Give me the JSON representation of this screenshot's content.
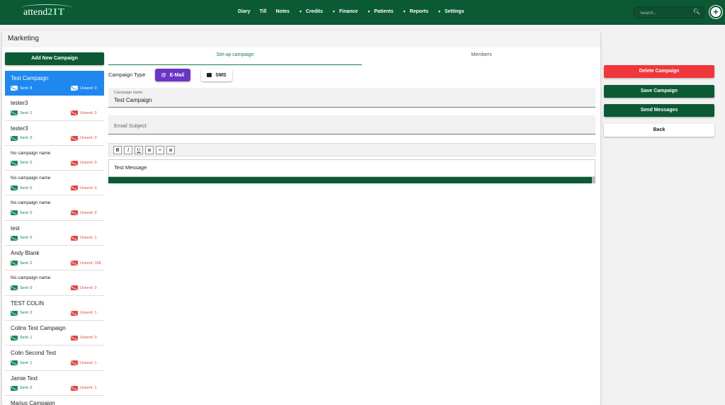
{
  "header": {
    "logo_text": "attend",
    "logo_accent": "2IT",
    "nav": [
      {
        "label": "Diary",
        "has_caret": false
      },
      {
        "label": "Till",
        "has_caret": false
      },
      {
        "label": "Notes",
        "has_caret": false
      },
      {
        "label": "Credits",
        "has_caret": true
      },
      {
        "label": "Finance",
        "has_caret": true
      },
      {
        "label": "Patients",
        "has_caret": true
      },
      {
        "label": "Reports",
        "has_caret": true
      },
      {
        "label": "Settings",
        "has_caret": true
      }
    ],
    "search_placeholder": "Search...",
    "search_icon": "search-icon",
    "add_icon": "plus-circle-icon"
  },
  "page": {
    "title": "Marketing",
    "add_button": "Add New Campaign"
  },
  "campaigns": [
    {
      "name": "Test Campaign",
      "small": false,
      "sent": "Sent: 8",
      "unsent": "Unsent: 0",
      "active": true
    },
    {
      "name": "tester3",
      "small": false,
      "sent": "Sent: 1",
      "unsent": "Unsent: 0",
      "active": false
    },
    {
      "name": "tester3",
      "small": false,
      "sent": "Sent: 0",
      "unsent": "Unsent: 0",
      "active": false
    },
    {
      "name": "No campaign name",
      "small": true,
      "sent": "Sent: 0",
      "unsent": "Unsent: 0",
      "active": false
    },
    {
      "name": "No campaign name",
      "small": true,
      "sent": "Sent: 0",
      "unsent": "Unsent: 0",
      "active": false
    },
    {
      "name": "No campaign name",
      "small": true,
      "sent": "Sent: 0",
      "unsent": "Unsent: 0",
      "active": false
    },
    {
      "name": "test",
      "small": false,
      "sent": "Sent: 0",
      "unsent": "Unsent: 1",
      "active": false
    },
    {
      "name": "Andy Blank",
      "small": false,
      "sent": "Sent: 0",
      "unsent": "Unsent: 158",
      "active": false
    },
    {
      "name": "No campaign name",
      "small": true,
      "sent": "Sent: 0",
      "unsent": "Unsent: 0",
      "active": false
    },
    {
      "name": "TEST COLIN",
      "small": false,
      "sent": "Sent: 0",
      "unsent": "Unsent: 1",
      "active": false
    },
    {
      "name": "Colins Test Campaign",
      "small": false,
      "sent": "Sent: 1",
      "unsent": "Unsent: 0",
      "active": false
    },
    {
      "name": "Colin Second Test",
      "small": false,
      "sent": "Sent: 1",
      "unsent": "Unsent: 1",
      "active": false
    },
    {
      "name": "Jamie Text",
      "small": false,
      "sent": "Sent: 0",
      "unsent": "Unsent: 1",
      "active": false
    },
    {
      "name": "Marius Campaign",
      "small": false,
      "sent": "",
      "unsent": "",
      "active": false
    }
  ],
  "tabs": {
    "setup": "Set-up campaign",
    "members": "Members"
  },
  "form": {
    "campaign_type_label": "Campaign Type",
    "email_button": "E-Mail",
    "email_icon": "@",
    "sms_button": "SMS",
    "campaign_name_label": "Campaign name",
    "campaign_name_value": "Test Campaign",
    "email_subject_placeholder": "Email Subject",
    "editor_buttons": [
      "B",
      "I",
      "U",
      "≣",
      "≡",
      "≣"
    ],
    "message_text": "Test Message"
  },
  "actions": {
    "delete": "Delete Campaign",
    "save": "Save Campaign",
    "send": "Send Messages",
    "back": "Back"
  },
  "colors": {
    "brand_green": "#0b5a35",
    "active_blue": "#1e88f0",
    "email_purple": "#6a35c8",
    "delete_red": "#f0363a"
  }
}
